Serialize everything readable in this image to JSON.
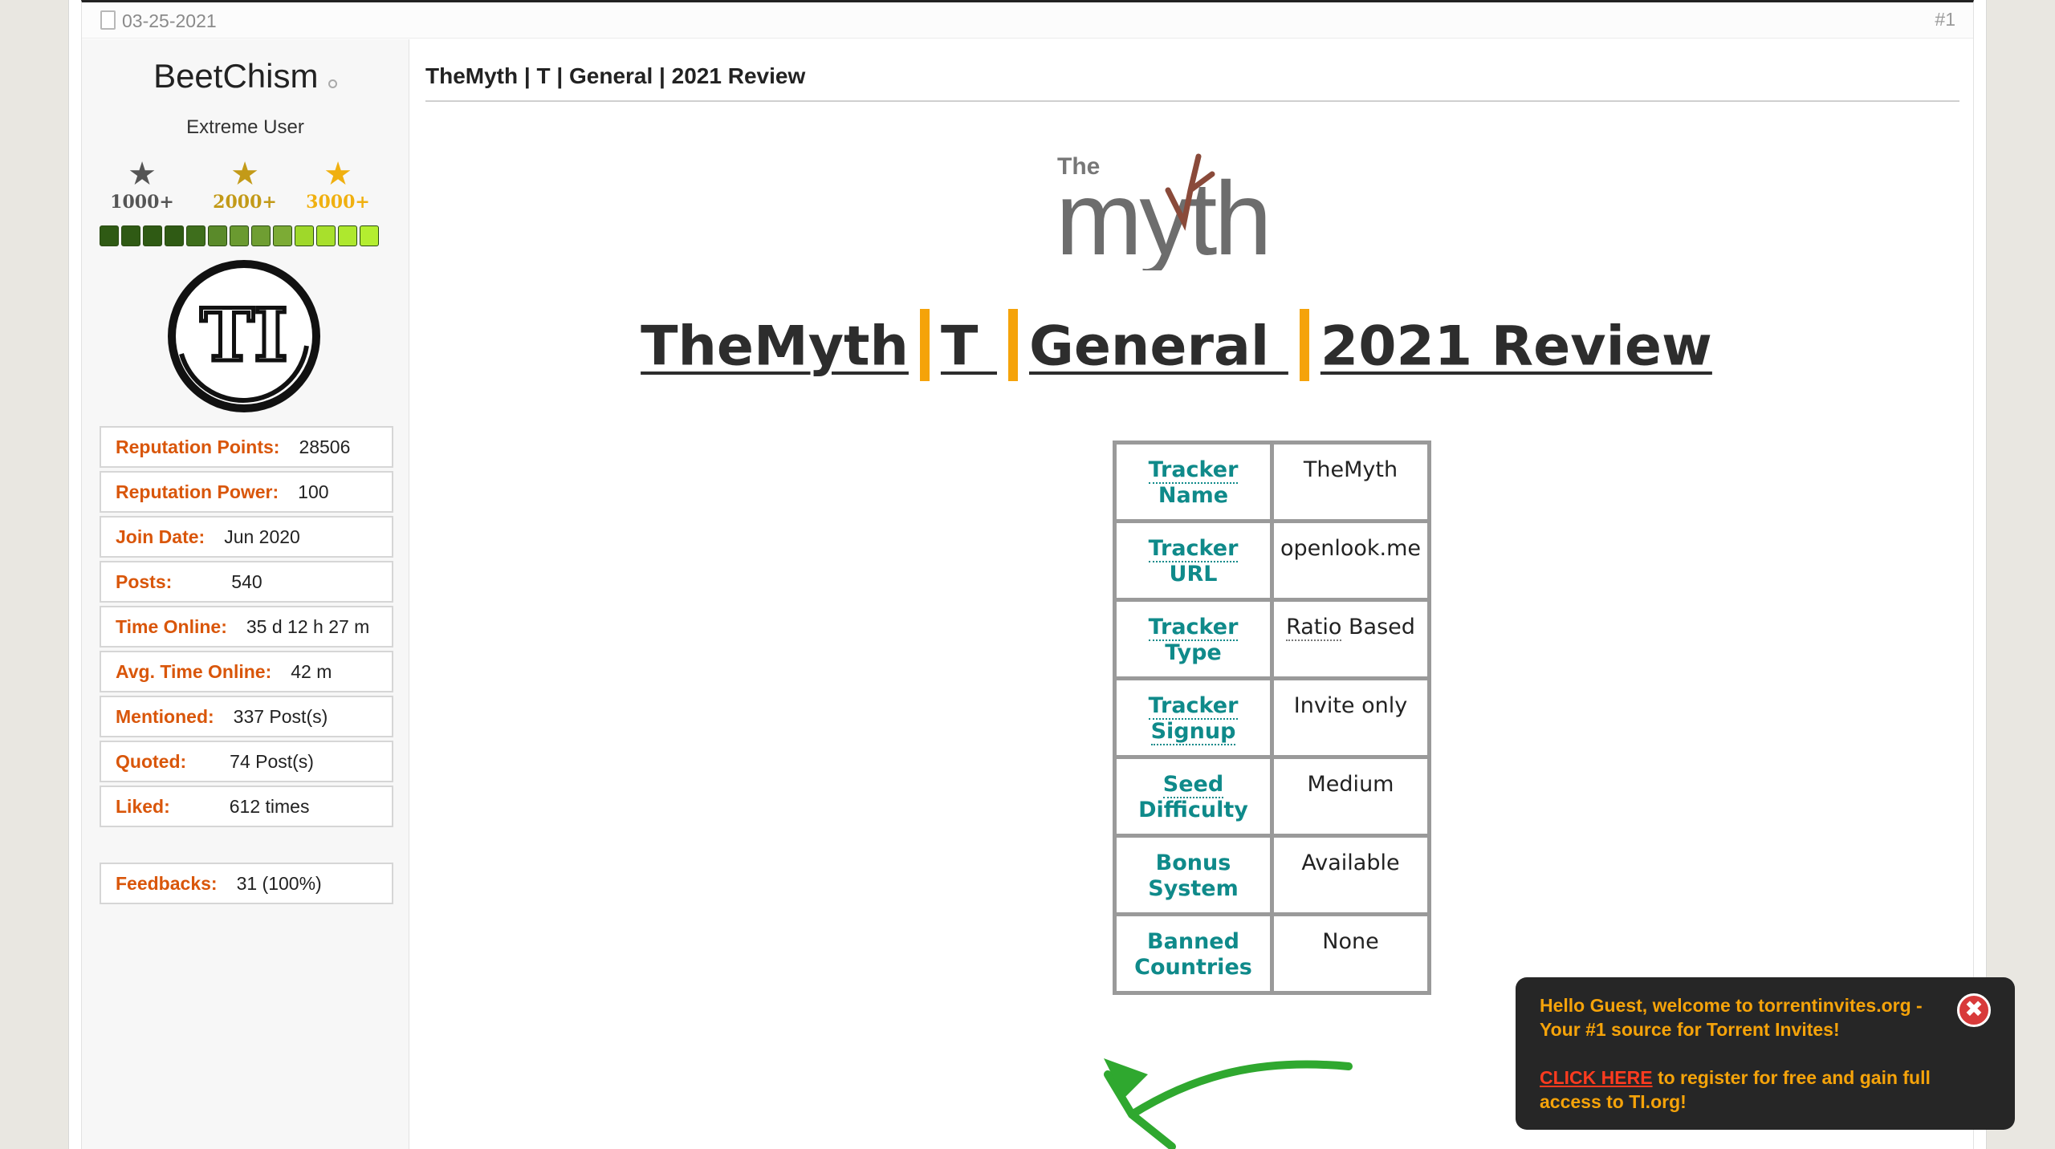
{
  "post": {
    "date": "03-25-2021",
    "number": "#1"
  },
  "user": {
    "username": "BeetChism",
    "title": "Extreme User",
    "stars": [
      {
        "label": "1000+",
        "color": "#555555"
      },
      {
        "label": "2000+",
        "color": "#c39a18"
      },
      {
        "label": "3000+",
        "color": "#f0b010"
      }
    ],
    "rep_bar_segments": 13,
    "avatar_text": "TI",
    "stats": [
      {
        "label": "Reputation Points:",
        "value": "28506"
      },
      {
        "label": "Reputation Power:",
        "value": "100"
      },
      {
        "label": "Join Date:",
        "value": "Jun 2020"
      },
      {
        "label": "Posts:",
        "value": "540"
      },
      {
        "label": "Time Online:",
        "value": "35 d 12 h 27 m"
      },
      {
        "label": "Avg. Time Online:",
        "value": "42 m"
      },
      {
        "label": "Mentioned:",
        "value": "337 Post(s)"
      },
      {
        "label": "Quoted:",
        "value": "74 Post(s)"
      },
      {
        "label": "Liked:",
        "value": "612 times"
      }
    ],
    "feedbacks": {
      "label": "Feedbacks:",
      "value": "31 (100%)"
    }
  },
  "content": {
    "post_title": "TheMyth | T | General | 2021 Review",
    "logo_small_text": "The",
    "logo_text": "myth",
    "heading_parts": [
      "TheMyth",
      "T ",
      "General ",
      "2021 Review"
    ],
    "table": [
      {
        "key_line1": "Tracker",
        "key_line2": "Name",
        "value": "TheMyth"
      },
      {
        "key_line1": "Tracker",
        "key_line2": "URL",
        "value": "openlook.me"
      },
      {
        "key_line1": "Tracker",
        "key_line2": "Type",
        "value_dotted": "Ratio",
        "value": " Based"
      },
      {
        "key_line1": "Tracker",
        "key_line2": "Signup",
        "value": "Invite only"
      },
      {
        "key_line1": "Seed",
        "key_line2": "Difficulty",
        "value": "Medium"
      },
      {
        "key_line1": "Bonus",
        "key_line2": "System",
        "value": "Available"
      },
      {
        "key_line1": "Banned",
        "key_line2": "Countries",
        "value": "None"
      }
    ]
  },
  "popup": {
    "greeting": "Hello Guest, welcome to torrentinvites.org - Your #1 source for Torrent Invites!",
    "link_text": "CLICK HERE",
    "cta_rest": " to register for free and gain full access to TI.org!",
    "close_glyph": "✖"
  },
  "colors": {
    "accent_orange": "#d9560a",
    "separator_orange": "#f5a30a",
    "teal": "#0f8a8a"
  }
}
